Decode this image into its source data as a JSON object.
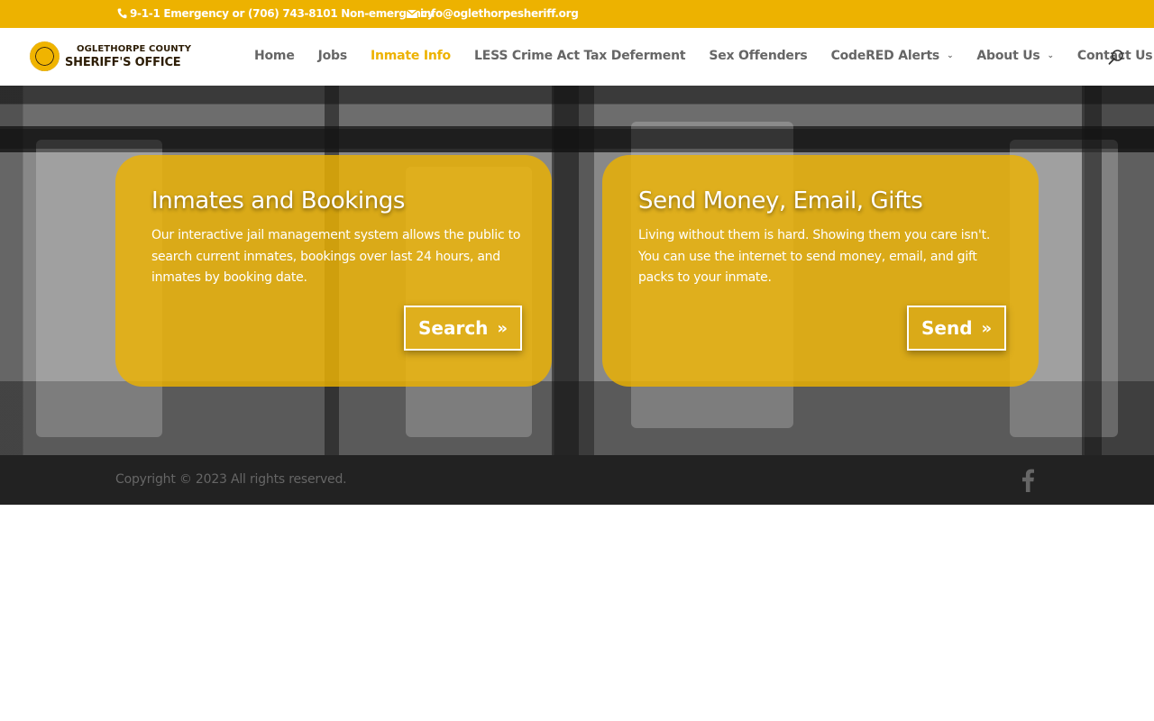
{
  "topbar": {
    "phone": "9-1-1 Emergency or (706) 743-8101 Non-emergency",
    "email": "info@oglethorpesheriff.org",
    "phone_icon": "phone-icon",
    "email_icon": "envelope-icon"
  },
  "logo": {
    "line1": "OGLETHORPE COUNTY",
    "line2": "SHERIFF'S OFFICE"
  },
  "nav": {
    "items": [
      {
        "label": "Home"
      },
      {
        "label": "Jobs"
      },
      {
        "label": "Inmate Info"
      },
      {
        "label": "LESS Crime Act Tax Deferment"
      },
      {
        "label": "Sex Offenders"
      },
      {
        "label": "CodeRED Alerts"
      },
      {
        "label": "About Us"
      },
      {
        "label": "Contact Us"
      }
    ],
    "active": "Inmate Info",
    "search_icon": "search-icon"
  },
  "cards": [
    {
      "title": "Inmates and Bookings",
      "body": "Our interactive jail management system allows the public to search current inmates, bookings over last 24 hours, and inmates by booking date.",
      "button": "Search"
    },
    {
      "title": "Send Money, Email, Gifts",
      "body": "Living without them is hard. Showing them you care isn't. You can use the internet to send money, email, and gift packs to your inmate.",
      "button": "Send"
    }
  ],
  "footer": {
    "copyright": "Copyright © 2023 All rights reserved.",
    "social_icon": "facebook-icon"
  },
  "colors": {
    "accent": "#edb200",
    "footer_bg": "#222222",
    "nav_text": "#666666"
  }
}
